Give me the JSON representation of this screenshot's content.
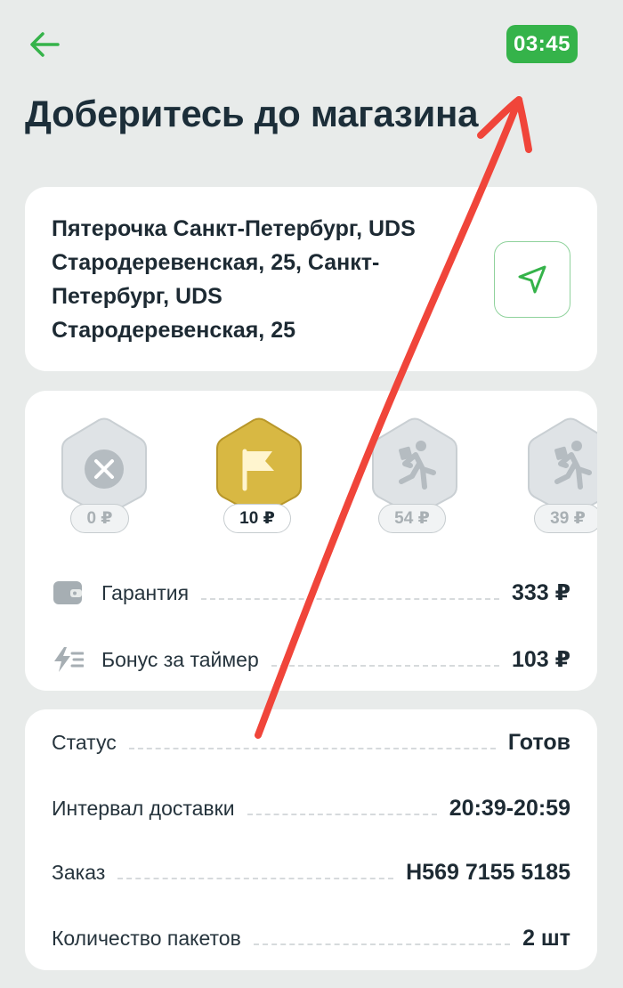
{
  "header": {
    "timer": "03:45",
    "title": "Доберитесь до магазина"
  },
  "address": {
    "text": "Пятерочка Санкт-Петербург, UDS Стародеревенская, 25, Санкт-Петербург, UDS Стародеревенская, 25"
  },
  "tiers": [
    {
      "icon": "close-icon",
      "amount": "0 ₽",
      "state": "inactive"
    },
    {
      "icon": "flag-icon",
      "amount": "10 ₽",
      "state": "active"
    },
    {
      "icon": "runner-icon",
      "amount": "54 ₽",
      "state": "inactive"
    },
    {
      "icon": "runner-icon",
      "amount": "39 ₽",
      "state": "inactive"
    }
  ],
  "payouts": {
    "guarantee_label": "Гарантия",
    "guarantee_value": "333 ₽",
    "timer_bonus_label": "Бонус за таймер",
    "timer_bonus_value": "103 ₽"
  },
  "details": {
    "status_label": "Статус",
    "status_value": "Готов",
    "interval_label": "Интервал доставки",
    "interval_value": "20:39-20:59",
    "order_label": "Заказ",
    "order_value": "H569 7155 5185",
    "bags_label": "Количество пакетов",
    "bags_value": "2 шт"
  },
  "colors": {
    "accent": "#35b34a",
    "background": "#e8ebea",
    "gold": "#d9b944",
    "annotation": "#f0453a"
  }
}
